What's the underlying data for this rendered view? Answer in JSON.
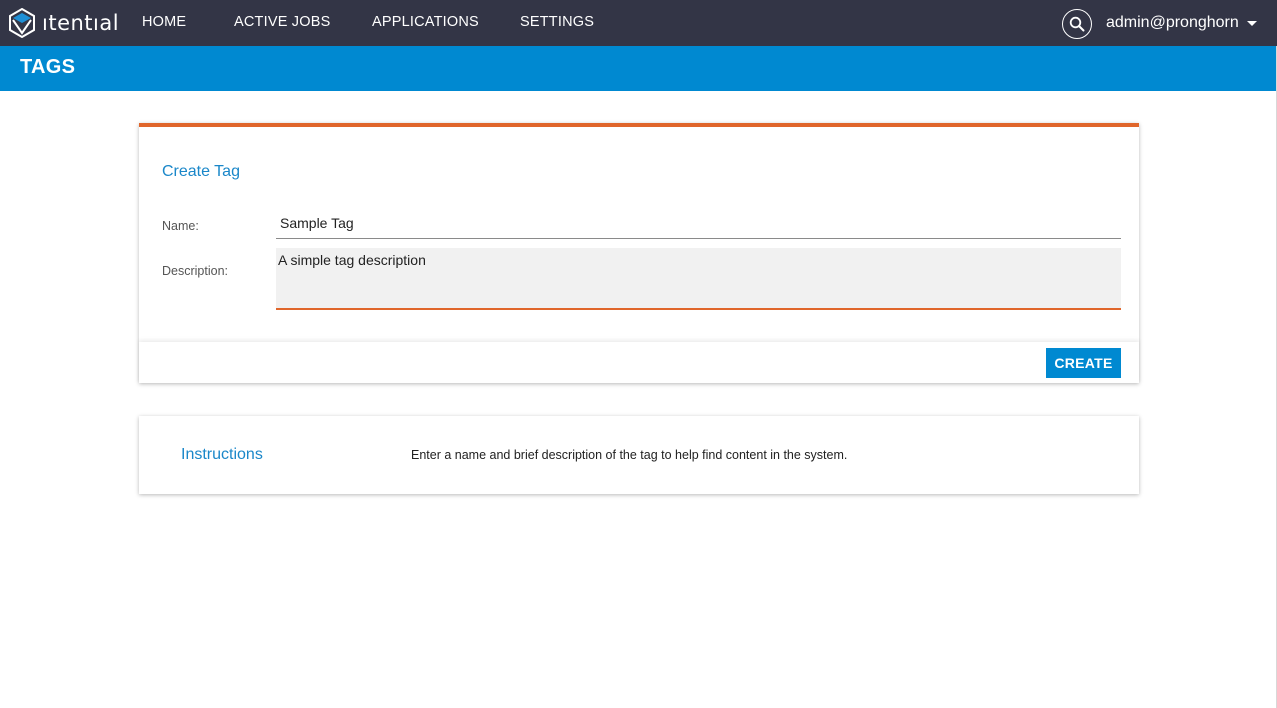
{
  "app": {
    "logo_text": "ıtentıal",
    "brand_color": "#0089d1",
    "nav_bg": "#333546",
    "accent_color": "#e0662b"
  },
  "nav": {
    "items": [
      {
        "label": "HOME"
      },
      {
        "label": "ACTIVE JOBS"
      },
      {
        "label": "APPLICATIONS"
      },
      {
        "label": "SETTINGS"
      }
    ],
    "search_icon": "search-icon",
    "user": "admin@pronghorn",
    "user_menu_icon": "caret-down-icon"
  },
  "page": {
    "title": "TAGS"
  },
  "form": {
    "title": "Create Tag",
    "name_label": "Name:",
    "name_value": "Sample Tag",
    "description_label": "Description:",
    "description_value": "A simple tag description",
    "create_label": "CREATE"
  },
  "instructions": {
    "title": "Instructions",
    "text": "Enter a name and brief description of the tag to help find content in the system."
  }
}
